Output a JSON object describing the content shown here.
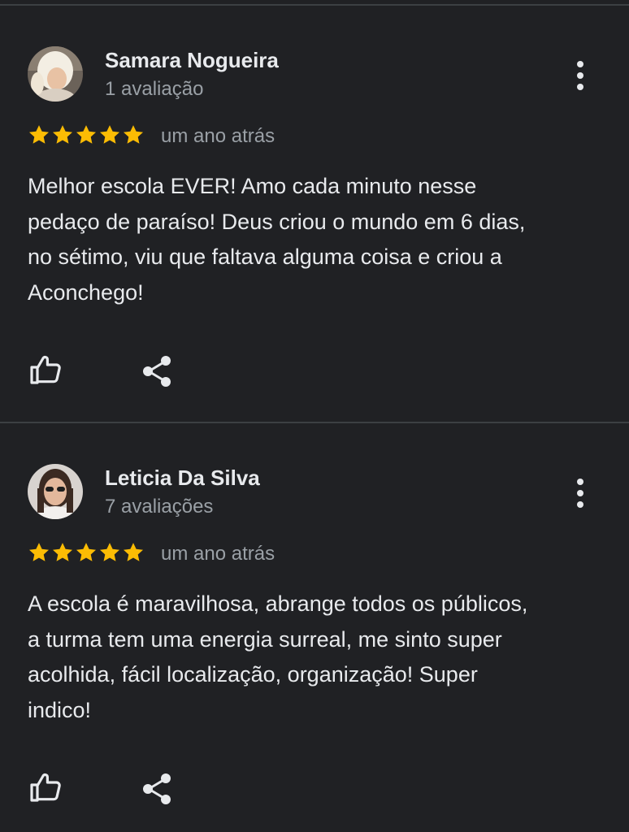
{
  "reviews": [
    {
      "author": "Samara Nogueira",
      "review_count": "1 avaliação",
      "rating": 5,
      "time": "um ano atrás",
      "text_lines": [
        "Melhor escola EVER! Amo cada minuto nesse",
        "pedaço de paraíso! Deus criou o mundo em 6 dias,",
        "no sétimo, viu que faltava alguma coisa e criou a",
        "Aconchego!"
      ]
    },
    {
      "author": "Leticia Da Silva",
      "review_count": "7 avaliações",
      "rating": 5,
      "time": "um ano atrás",
      "text_lines": [
        "A escola é maravilhosa, abrange todos os públicos,",
        "a turma tem uma energia surreal, me sinto super",
        "acolhida, fácil localização, organização! Super",
        "indico!"
      ]
    }
  ],
  "icons": {
    "star": "star-icon",
    "like": "thumb-up-icon",
    "share": "share-icon",
    "menu": "more-vert-icon"
  },
  "colors": {
    "background": "#202124",
    "star": "#fbbc04",
    "text_primary": "#e8eaed",
    "text_secondary": "#9aa0a6",
    "divider": "#3c4043"
  }
}
